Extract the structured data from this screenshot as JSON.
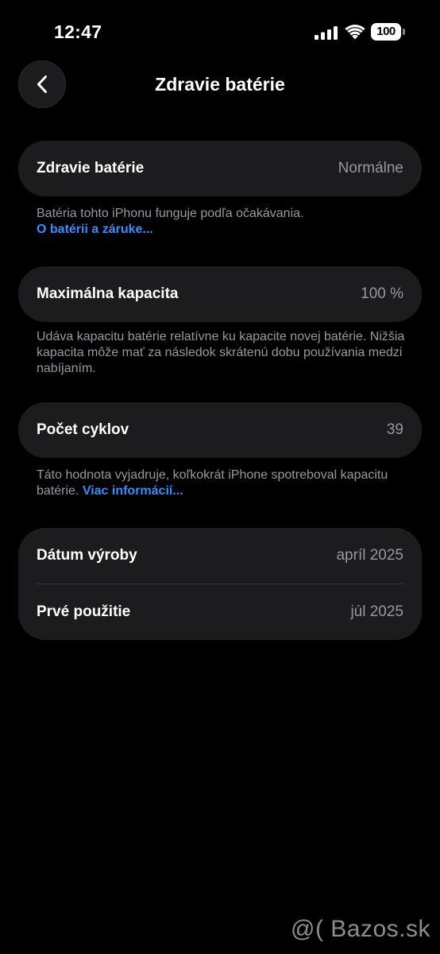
{
  "status_bar": {
    "time": "12:47",
    "battery_level": "100"
  },
  "nav": {
    "title": "Zdravie batérie"
  },
  "sections": {
    "health": {
      "label": "Zdravie batérie",
      "value": "Normálne",
      "footnote": "Batéria tohto iPhonu funguje podľa očakávania.",
      "link": "O batérii a záruke..."
    },
    "capacity": {
      "label": "Maximálna kapacita",
      "value": "100 %",
      "footnote": "Udáva kapacitu batérie relatívne ku kapacite novej batérie. Nižšia kapacita môže mať za následok skrátenú dobu používania medzi nabíjaním."
    },
    "cycles": {
      "label": "Počet cyklov",
      "value": "39",
      "footnote": "Táto hodnota vyjadruje, koľkokrát iPhone spotreboval kapacitu batérie. ",
      "link": "Viac informácií..."
    },
    "dates": {
      "manufacture_label": "Dátum výroby",
      "manufacture_value": "apríl 2025",
      "first_use_label": "Prvé použitie",
      "first_use_value": "júl 2025"
    }
  },
  "watermark": "@( Bazos.sk",
  "colors": {
    "background": "#000000",
    "card": "#1c1c1e",
    "secondary_text": "#98989f",
    "link": "#3a8cff"
  }
}
